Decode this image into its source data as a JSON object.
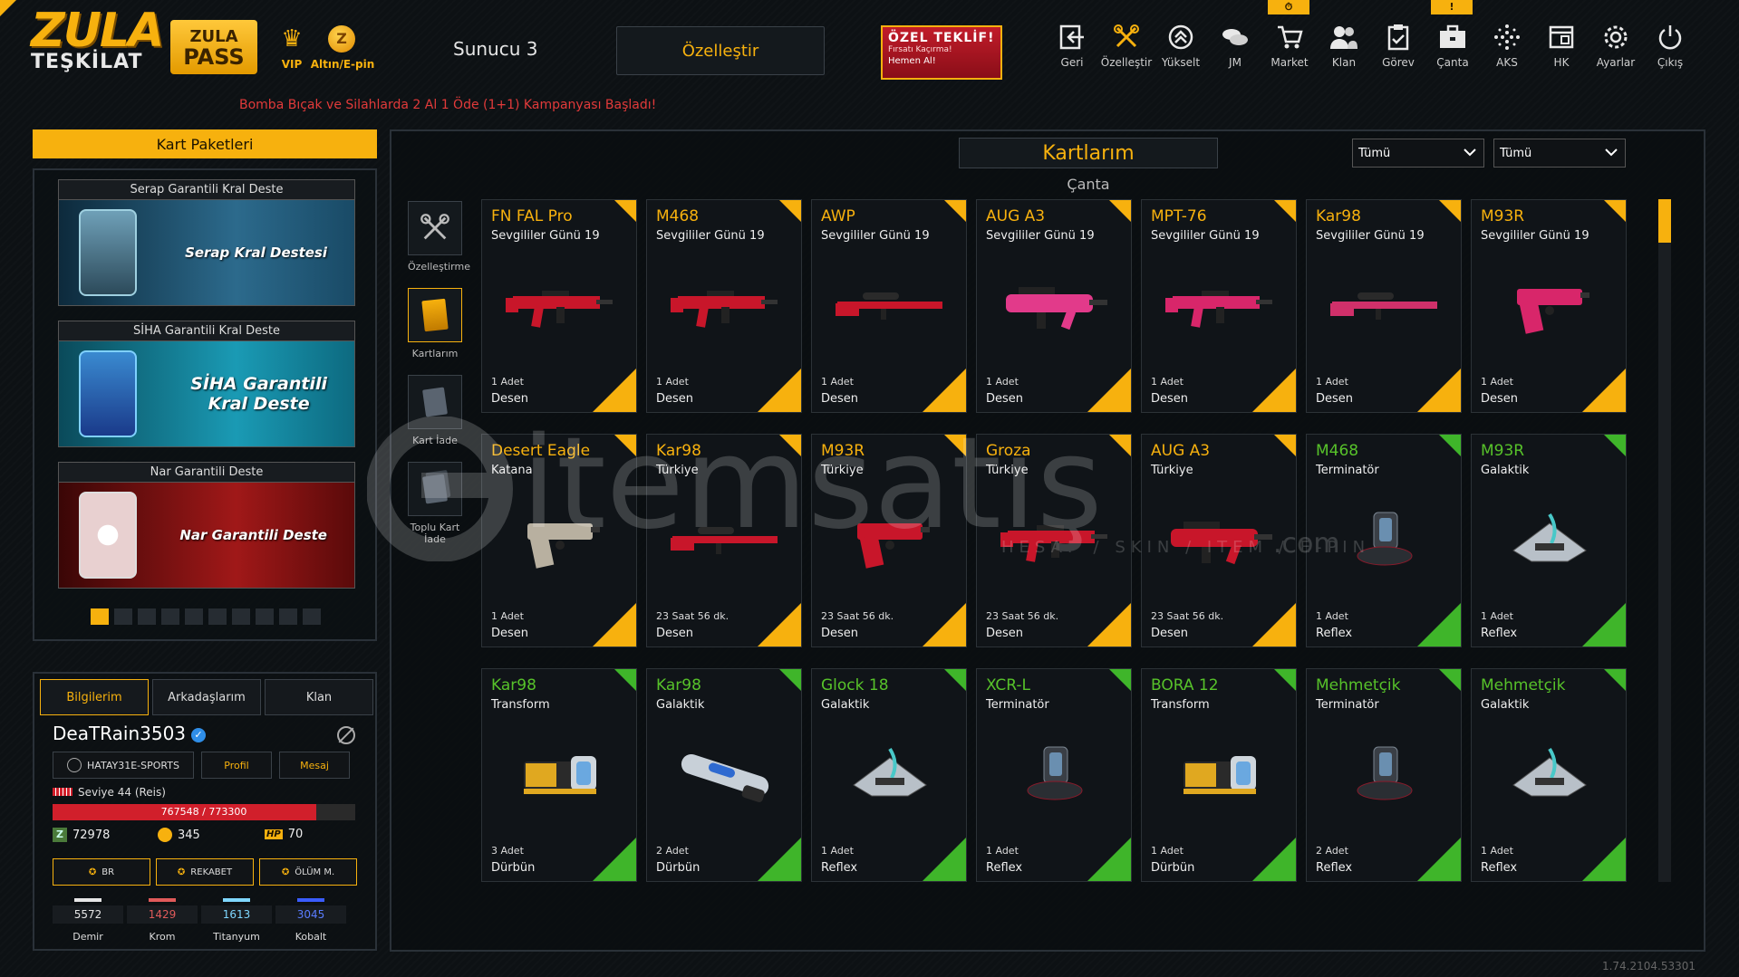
{
  "header": {
    "logo_line1": "ZULA",
    "logo_line2": "TEŞKİLAT",
    "pass_line1": "ZULA",
    "pass_line2": "PASS",
    "vip_label": "VIP",
    "gold_label": "Altın/E-pin",
    "server": "Sunucu 3",
    "customize": "Özelleştir",
    "offer_title": "ÖZEL TEKLİF!",
    "offer_sub": "Fırsatı Kaçırma!",
    "offer_cta": "Hemen Al!",
    "announcement": "Bomba Bıçak ve Silahlarda 2 Al 1 Öde (1+1) Kampanyası Başladı!"
  },
  "nav": [
    {
      "label": "Geri",
      "icon": "back-icon"
    },
    {
      "label": "Özelleştir",
      "icon": "tools-icon"
    },
    {
      "label": "Yükselt",
      "icon": "upgrade-icon"
    },
    {
      "label": "JM",
      "icon": "coins-icon"
    },
    {
      "label": "Market",
      "icon": "cart-icon"
    },
    {
      "label": "Klan",
      "icon": "clan-icon"
    },
    {
      "label": "Görev",
      "icon": "clipboard-icon"
    },
    {
      "label": "Çanta",
      "icon": "bag-icon"
    },
    {
      "label": "AKS",
      "icon": "dots-icon"
    },
    {
      "label": "HK",
      "icon": "window-icon"
    },
    {
      "label": "Ayarlar",
      "icon": "gear-icon"
    },
    {
      "label": "Çıkış",
      "icon": "power-icon"
    }
  ],
  "left": {
    "packages_title": "Kart Paketleri",
    "decks": [
      {
        "title": "Serap Garantili Kral Deste",
        "name": "Serap Kral Destesi"
      },
      {
        "title": "SİHA Garantili Kral Deste",
        "name_l1": "SİHA Garantili",
        "name_l2": "Kral Deste"
      },
      {
        "title": "Nar Garantili Deste",
        "name": "Nar Garantili Deste"
      }
    ],
    "tabs": [
      "Bilgilerim",
      "Arkadaşlarım",
      "Klan"
    ],
    "username": "DeaTRain3503",
    "clan_tag": "HATAY31E-SPORTS",
    "profile_btn": "Profil",
    "message_btn": "Mesaj",
    "level": "Seviye 44 (Reis)",
    "xp": "767548 / 773300",
    "xp_fraction": 0.87,
    "currency_z": "72978",
    "currency_gold": "345",
    "currency_hp_label": "HP",
    "currency_hp": "70",
    "modes": [
      "BR",
      "REKABET",
      "ÖLÜM M."
    ],
    "ranks": [
      {
        "name": "Demir",
        "value": "5572",
        "color": "#e6e6e6"
      },
      {
        "name": "Krom",
        "value": "1429",
        "color": "#e05a5a"
      },
      {
        "name": "Titanyum",
        "value": "1613",
        "color": "#7fd7ff"
      },
      {
        "name": "Kobalt",
        "value": "3045",
        "color": "#3a5cff"
      }
    ]
  },
  "main": {
    "title": "Kartlarım",
    "subtitle": "Çanta",
    "filter1": "Tümü",
    "filter2": "Tümü",
    "tools": [
      "Özelleştirme",
      "Kartlarım",
      "Kart İade",
      "Toplu Kart İade"
    ],
    "cards": [
      {
        "name": "FN FAL Pro",
        "skin": "Sevgililer Günü 19",
        "count": "1 Adet",
        "type": "Desen",
        "tier": "gold",
        "art": "rifle-red"
      },
      {
        "name": "M468",
        "skin": "Sevgililer Günü 19",
        "count": "1 Adet",
        "type": "Desen",
        "tier": "gold",
        "art": "rifle-red"
      },
      {
        "name": "AWP",
        "skin": "Sevgililer Günü 19",
        "count": "1 Adet",
        "type": "Desen",
        "tier": "gold",
        "art": "sniper-red"
      },
      {
        "name": "AUG A3",
        "skin": "Sevgililer Günü 19",
        "count": "1 Adet",
        "type": "Desen",
        "tier": "gold",
        "art": "bullpup-pink"
      },
      {
        "name": "MPT-76",
        "skin": "Sevgililer Günü 19",
        "count": "1 Adet",
        "type": "Desen",
        "tier": "gold",
        "art": "rifle-pink"
      },
      {
        "name": "Kar98",
        "skin": "Sevgililer Günü 19",
        "count": "1 Adet",
        "type": "Desen",
        "tier": "gold",
        "art": "sniper-pink"
      },
      {
        "name": "M93R",
        "skin": "Sevgililer Günü 19",
        "count": "1 Adet",
        "type": "Desen",
        "tier": "gold",
        "art": "pistol-pink"
      },
      {
        "name": "Desert Eagle",
        "skin": "Katana",
        "count": "1 Adet",
        "type": "Desen",
        "tier": "gold",
        "art": "pistol-gold"
      },
      {
        "name": "Kar98",
        "skin": "Türkiye",
        "count": "23 Saat 56 dk.",
        "type": "Desen",
        "tier": "gold",
        "art": "sniper-red"
      },
      {
        "name": "M93R",
        "skin": "Türkiye",
        "count": "23 Saat 56 dk.",
        "type": "Desen",
        "tier": "gold",
        "art": "pistol-red"
      },
      {
        "name": "Groza",
        "skin": "Türkiye",
        "count": "23 Saat 56 dk.",
        "type": "Desen",
        "tier": "gold",
        "art": "rifle-red"
      },
      {
        "name": "AUG A3",
        "skin": "Türkiye",
        "count": "23 Saat 56 dk.",
        "type": "Desen",
        "tier": "gold",
        "art": "bullpup-red"
      },
      {
        "name": "M468",
        "skin": "Terminatör",
        "count": "1 Adet",
        "type": "Reflex",
        "tier": "green",
        "art": "reflex-dark"
      },
      {
        "name": "M93R",
        "skin": "Galaktik",
        "count": "1 Adet",
        "type": "Reflex",
        "tier": "green",
        "art": "reflex-silver"
      },
      {
        "name": "Kar98",
        "skin": "Transform",
        "count": "3 Adet",
        "type": "Dürbün",
        "tier": "green",
        "art": "scope-gold"
      },
      {
        "name": "Kar98",
        "skin": "Galaktik",
        "count": "2 Adet",
        "type": "Dürbün",
        "tier": "green",
        "art": "scope-silver"
      },
      {
        "name": "Glock 18",
        "skin": "Galaktik",
        "count": "1 Adet",
        "type": "Reflex",
        "tier": "green",
        "art": "reflex-silver"
      },
      {
        "name": "XCR-L",
        "skin": "Terminatör",
        "count": "1 Adet",
        "type": "Reflex",
        "tier": "green",
        "art": "reflex-dark"
      },
      {
        "name": "BORA 12",
        "skin": "Transform",
        "count": "1 Adet",
        "type": "Dürbün",
        "tier": "green",
        "art": "scope-gold"
      },
      {
        "name": "Mehmetçik",
        "skin": "Terminatör",
        "count": "2 Adet",
        "type": "Reflex",
        "tier": "green",
        "art": "reflex-dark"
      },
      {
        "name": "Mehmetçik",
        "skin": "Galaktik",
        "count": "1 Adet",
        "type": "Reflex",
        "tier": "green",
        "art": "reflex-silver"
      }
    ]
  },
  "watermark": {
    "text": "itemsatış",
    "sub": "HESAP / SKIN / ITEM / E-PIN",
    "suffix": ".com"
  },
  "version": "1.74.2104.53301",
  "colors": {
    "accent": "#f7b10e",
    "green_tier": "#3fb52a",
    "xp": "#d11f2b"
  }
}
